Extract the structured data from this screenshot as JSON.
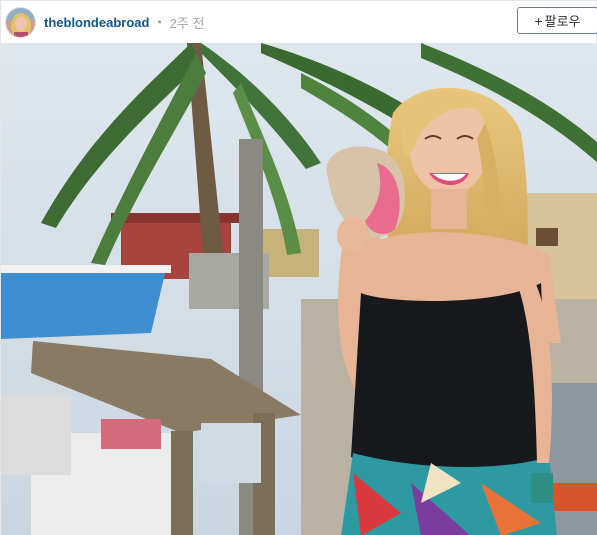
{
  "post": {
    "username": "theblondeabroad",
    "separator": "•",
    "timestamp": "2주 전",
    "follow_label": "팔로우",
    "follow_icon": "plus-icon"
  },
  "colors": {
    "username": "#125688",
    "muted": "#a5a7aa",
    "button_border": "#6a7d8e"
  }
}
